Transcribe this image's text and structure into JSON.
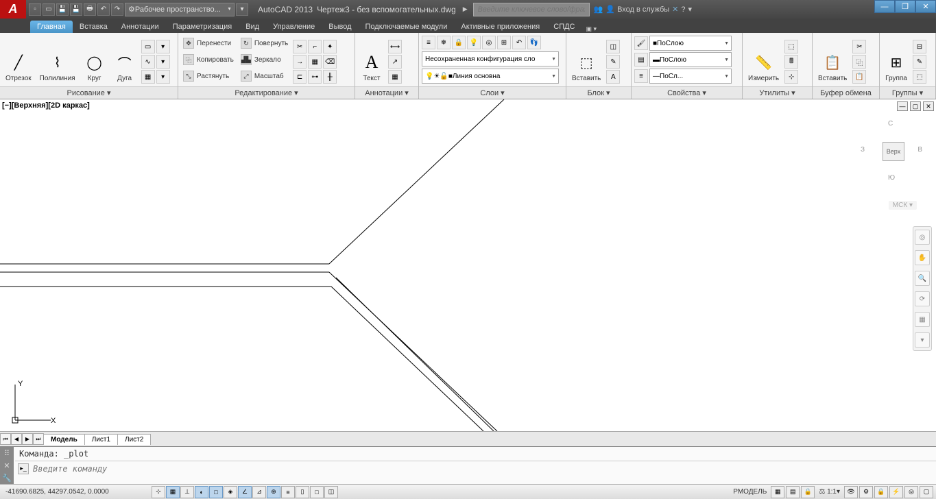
{
  "title": {
    "app": "AutoCAD 2013",
    "doc": "Чертеж3 - без вспомогательных.dwg",
    "workspace": "Рабочее пространство...",
    "search_placeholder": "Введите ключевое слово/фразу",
    "login": "Вход в службы"
  },
  "tabs": {
    "items": [
      "Главная",
      "Вставка",
      "Аннотации",
      "Параметризация",
      "Вид",
      "Управление",
      "Вывод",
      "Подключаемые модули",
      "Активные приложения",
      "СПДС"
    ],
    "active": 0
  },
  "ribbon": {
    "draw": {
      "title": "Рисование",
      "line": "Отрезок",
      "polyline": "Полилиния",
      "circle": "Круг",
      "arc": "Дуга"
    },
    "edit": {
      "title": "Редактирование",
      "move": "Перенести",
      "copy": "Копировать",
      "stretch": "Растянуть",
      "rotate": "Повернуть",
      "mirror": "Зеркало",
      "scale": "Масштаб"
    },
    "annot": {
      "title": "Аннотации",
      "text": "Текст"
    },
    "layers": {
      "title": "Слои",
      "state": "Несохраненная конфигурация сло",
      "current": "Линия основна"
    },
    "block": {
      "title": "Блок",
      "insert": "Вставить"
    },
    "props": {
      "title": "Свойства",
      "color": "ПоСлою",
      "lineweight": "ПоСлою",
      "linetype": "ПоСл..."
    },
    "utils": {
      "title": "Утилиты",
      "measure": "Измерить"
    },
    "clip": {
      "title": "Буфер обмена",
      "paste": "Вставить"
    },
    "groups": {
      "title": "Группы",
      "group": "Группа"
    }
  },
  "viewport": {
    "label": "[−][Верхняя][2D каркас]",
    "cube": {
      "top": "Верх",
      "n": "С",
      "s": "Ю",
      "e": "В",
      "w": "З"
    },
    "msk": "МСК",
    "ucs": {
      "x": "X",
      "y": "Y"
    }
  },
  "layout_tabs": {
    "model": "Модель",
    "sheet1": "Лист1",
    "sheet2": "Лист2"
  },
  "command": {
    "history": "Команда: _plot",
    "placeholder": "Введите команду"
  },
  "status": {
    "coords": "-41690.6825, 44297.0542, 0.0000",
    "model": "РМОДЕЛЬ",
    "scale": "1:1"
  }
}
